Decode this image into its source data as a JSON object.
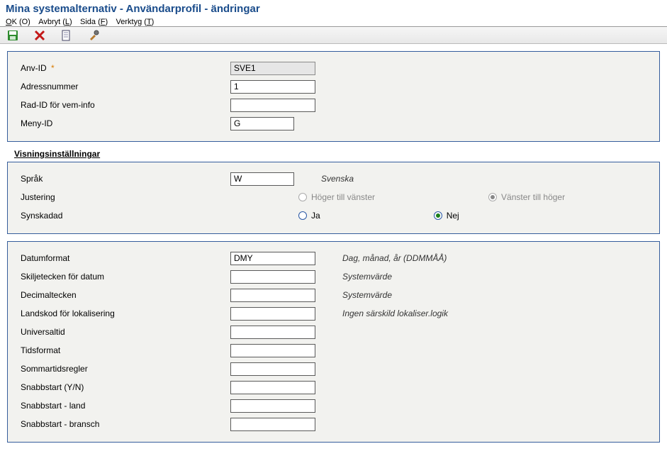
{
  "title": "Mina systemalternativ - Användarprofil - ändringar",
  "menu": {
    "ok": "OK (O)",
    "cancel": "Avbryt (L)",
    "page": "Sida (F)",
    "tools": "Verktyg (T)"
  },
  "toolbar_icons": {
    "save": "save-icon",
    "cancel": "cancel-icon",
    "page": "page-icon",
    "tools": "tools-icon"
  },
  "top": {
    "user_id": {
      "label": "Anv-ID",
      "value": "SVE1",
      "required": "*"
    },
    "address_no": {
      "label": "Adressnummer",
      "value": "1"
    },
    "row_id": {
      "label": "Rad-ID för vem-info",
      "value": ""
    },
    "menu_id": {
      "label": "Meny-ID",
      "value": "G"
    }
  },
  "section_display_title": "Visningsinställningar",
  "display": {
    "language": {
      "label": "Språk",
      "value": "W",
      "desc": "Svenska"
    },
    "justification": {
      "label": "Justering",
      "opt_rtl": "Höger till vänster",
      "opt_ltr": "Vänster till höger",
      "selected": "ltr"
    },
    "impaired": {
      "label": "Synskadad",
      "opt_yes": "Ja",
      "opt_no": "Nej",
      "selected": "no"
    }
  },
  "fmt": {
    "date_format": {
      "label": "Datumformat",
      "value": "DMY",
      "desc": "Dag, månad, år (DDMMÅÅ)"
    },
    "date_sep": {
      "label": "Skiljetecken för datum",
      "value": "",
      "desc": "Systemvärde"
    },
    "decimal": {
      "label": "Decimaltecken",
      "value": "",
      "desc": "Systemvärde"
    },
    "country": {
      "label": "Landskod för lokalisering",
      "value": "",
      "desc": "Ingen särskild lokaliser.logik"
    },
    "universal_time": {
      "label": "Universaltid",
      "value": ""
    },
    "time_format": {
      "label": "Tidsformat",
      "value": ""
    },
    "dst": {
      "label": "Sommartidsregler",
      "value": ""
    },
    "quickstart": {
      "label": "Snabbstart (Y/N)",
      "value": ""
    },
    "quickstart_country": {
      "label": "Snabbstart - land",
      "value": ""
    },
    "quickstart_industry": {
      "label": "Snabbstart - bransch",
      "value": ""
    }
  }
}
